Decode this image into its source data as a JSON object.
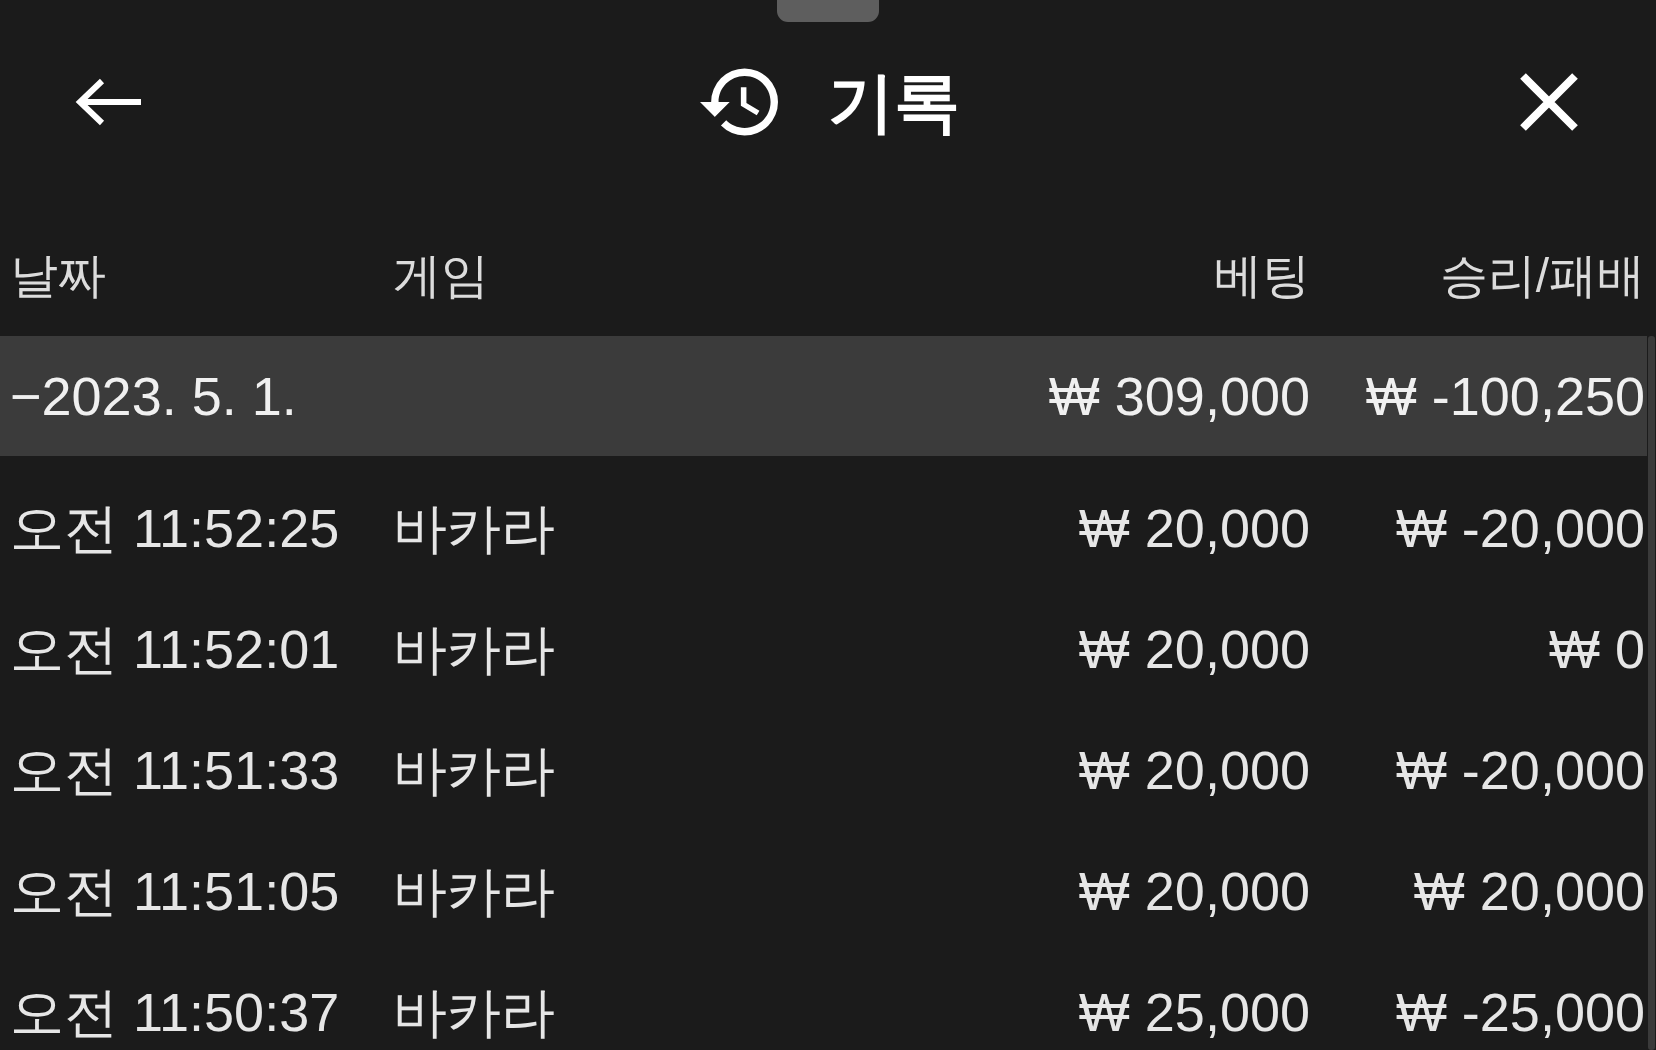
{
  "header": {
    "title": "기록"
  },
  "table": {
    "columns": [
      "날짜",
      "게임",
      "베팅",
      "승리/패배"
    ],
    "rows": [
      {
        "kind": "summary",
        "date": "−2023. 5. 1.",
        "bet": "₩ 309,000",
        "result": "₩ -100,250"
      },
      {
        "kind": "entry",
        "time": "오전 11:52:25",
        "game": "바카라",
        "bet": "₩ 20,000",
        "result": "₩ -20,000"
      },
      {
        "kind": "entry",
        "time": "오전 11:52:01",
        "game": "바카라",
        "bet": "₩ 20,000",
        "result": "₩ 0"
      },
      {
        "kind": "entry",
        "time": "오전 11:51:33",
        "game": "바카라",
        "bet": "₩ 20,000",
        "result": "₩ -20,000"
      },
      {
        "kind": "entry",
        "time": "오전 11:51:05",
        "game": "바카라",
        "bet": "₩ 20,000",
        "result": "₩ 20,000"
      },
      {
        "kind": "entry",
        "time": "오전 11:50:37",
        "game": "바카라",
        "bet": "₩ 25,000",
        "result": "₩ -25,000"
      }
    ]
  }
}
